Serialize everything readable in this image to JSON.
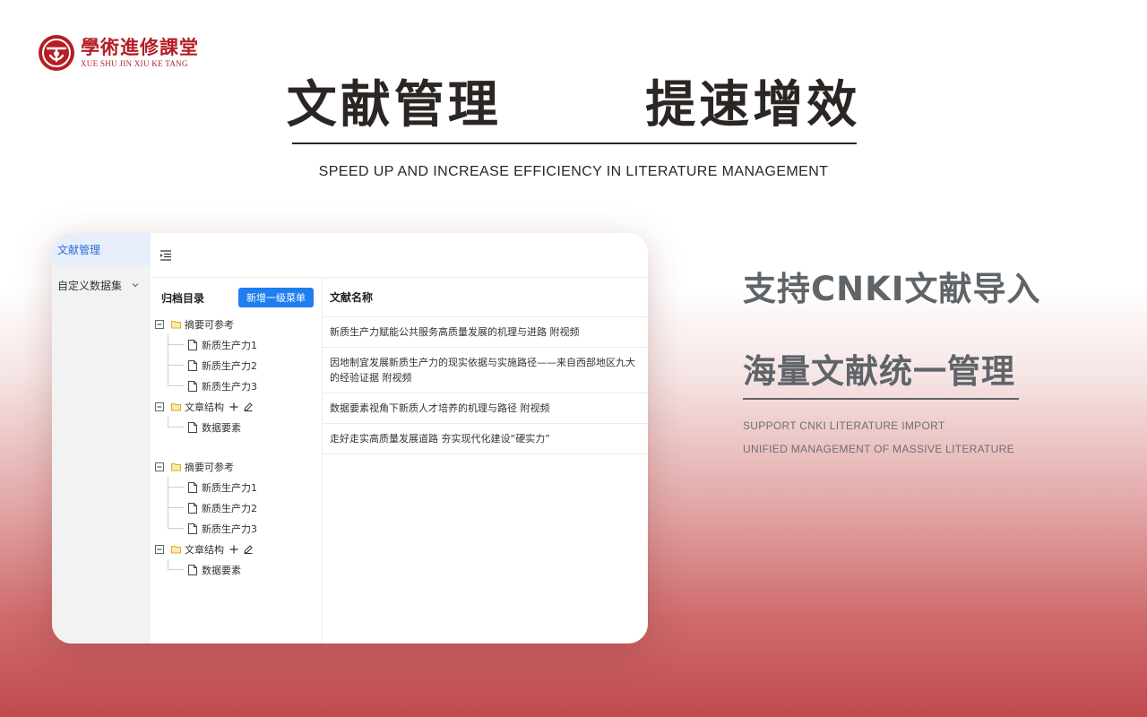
{
  "logo": {
    "cn": "學術進修課堂",
    "en": "XUE SHU JIN XIU KE TANG"
  },
  "header": {
    "title": "文献管理   提速增效",
    "subtitle": "SPEED UP AND INCREASE EFFICIENCY IN LITERATURE MANAGEMENT"
  },
  "app": {
    "sidebar": {
      "items": [
        {
          "label": "文献管理",
          "active": true
        },
        {
          "label": "自定义数据集",
          "active": false
        }
      ]
    },
    "tree": {
      "title": "归档目录",
      "add_button": "新增一级菜单",
      "groups": [
        {
          "parents": [
            {
              "label": "摘要可参考",
              "children": [
                "新质生产力1",
                "新质生产力2",
                "新质生产力3"
              ]
            },
            {
              "label": "文章结构",
              "children": [
                "数据要素"
              ]
            }
          ]
        },
        {
          "parents": [
            {
              "label": "摘要可参考",
              "children": [
                "新质生产力1",
                "新质生产力2",
                "新质生产力3"
              ]
            },
            {
              "label": "文章结构",
              "children": [
                "数据要素"
              ]
            }
          ]
        }
      ]
    },
    "list": {
      "header": "文献名称",
      "rows": [
        {
          "lines": [
            "新质生产力赋能公共服务高质量发展的机理与进路 附视频"
          ]
        },
        {
          "lines": [
            "因地制宜发展新质生产力的现实依据与实施路径——来自西部地区九大",
            "的经验证据 附视频"
          ]
        },
        {
          "lines": [
            "数据要素视角下新质人才培养的机理与路径 附视频"
          ]
        },
        {
          "lines": [
            "走好走实高质量发展道路 夯实现代化建设“硬实力”"
          ]
        }
      ]
    }
  },
  "features": {
    "line1": "支持CNKI文献导入",
    "line2": "海量文献统一管理",
    "en1": "SUPPORT CNKI LITERATURE IMPORT",
    "en2": "UNIFIED MANAGEMENT OF MASSIVE LITERATURE"
  },
  "colors": {
    "brand_red": "#b51e24",
    "accent_blue": "#1f7ef0",
    "text_dark": "#2b2523",
    "text_gray": "#5f6468"
  },
  "icons": {
    "logo": "seal-logo-icon",
    "menu": "menu-fold-icon",
    "collapse": "minus-square-icon",
    "folder": "folder-open-icon",
    "file": "file-icon",
    "add": "plus-icon",
    "edit": "pencil-icon",
    "chevron": "chevron-down-icon"
  }
}
